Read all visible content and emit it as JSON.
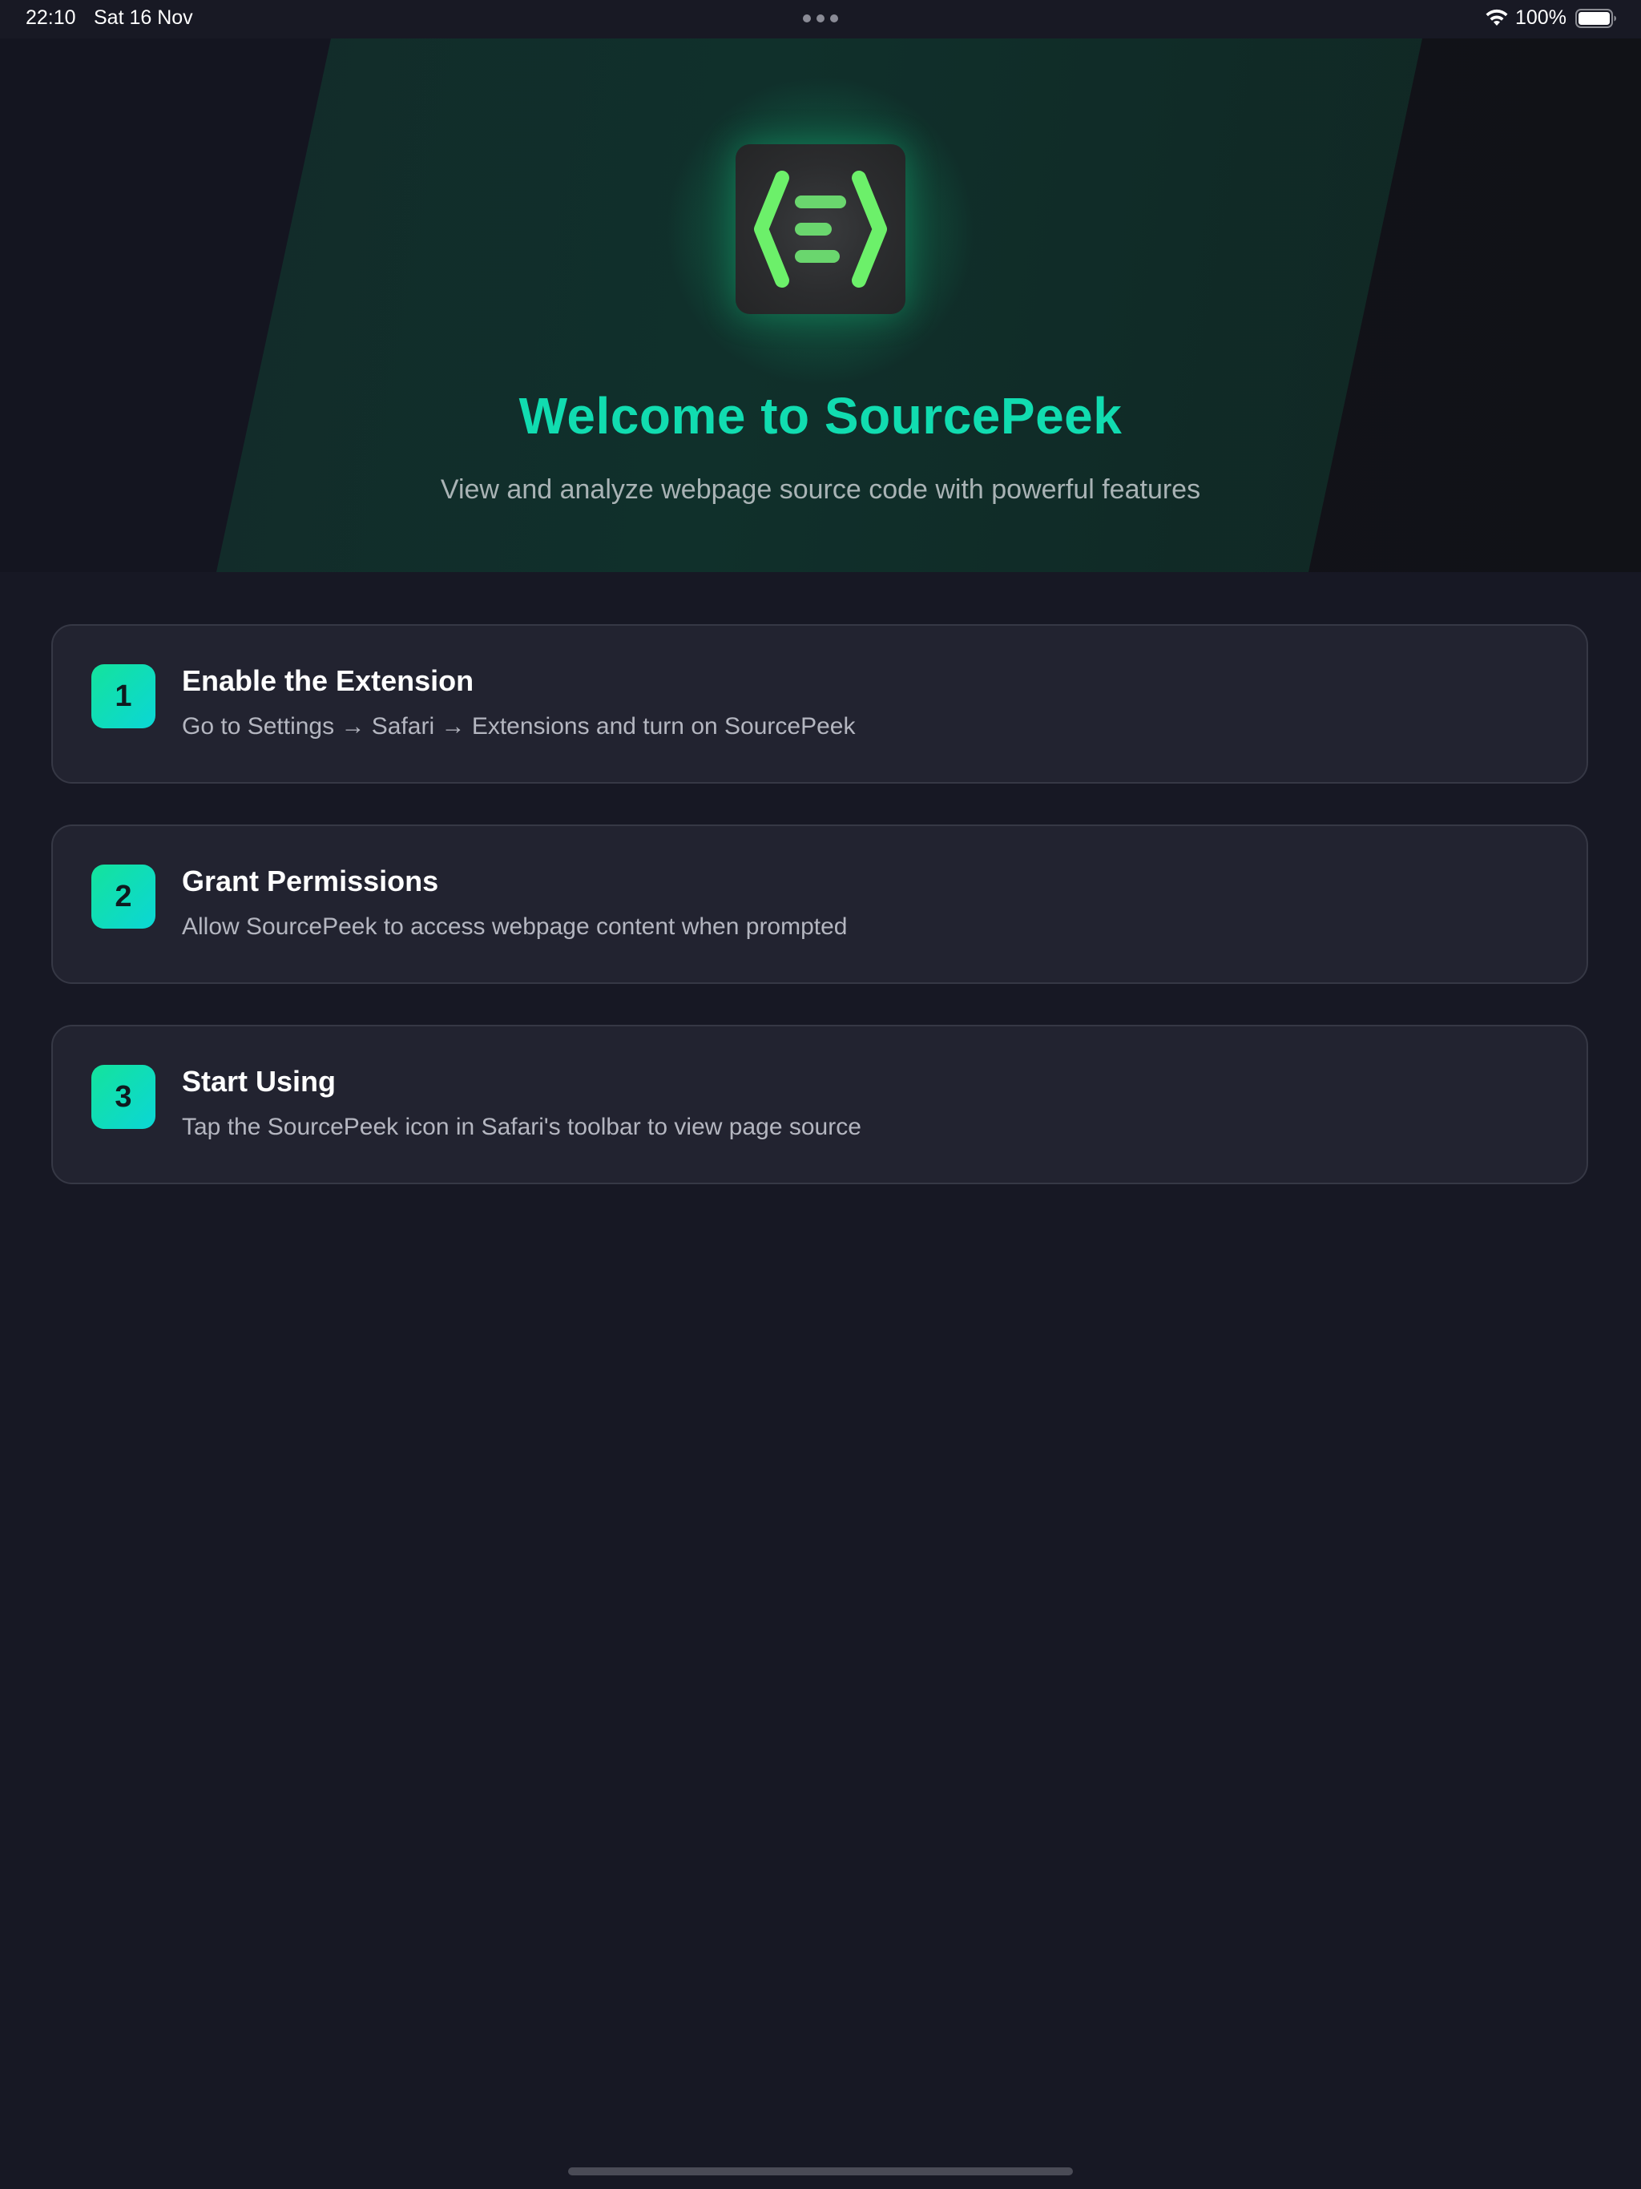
{
  "status_bar": {
    "time": "22:10",
    "date": "Sat 16 Nov",
    "battery": "100%",
    "wifi_icon": "wifi-icon",
    "battery_icon": "battery-icon"
  },
  "hero": {
    "logo_icon": "code-brackets-icon",
    "title": "Welcome to SourcePeek",
    "subtitle": "View and analyze webpage source code with powerful features"
  },
  "steps": [
    {
      "number": "1",
      "title": "Enable the Extension",
      "description": "Go to Settings → Safari → Extensions and turn on SourcePeek"
    },
    {
      "number": "2",
      "title": "Grant Permissions",
      "description": "Allow SourcePeek to access webpage content when prompted"
    },
    {
      "number": "3",
      "title": "Start Using",
      "description": "Tap the SourcePeek icon in Safari's toolbar to view page source"
    }
  ],
  "colors": {
    "background": "#171824",
    "accent": "#11dcb0",
    "logo_green": "#6cf06a",
    "card": "#222330"
  }
}
